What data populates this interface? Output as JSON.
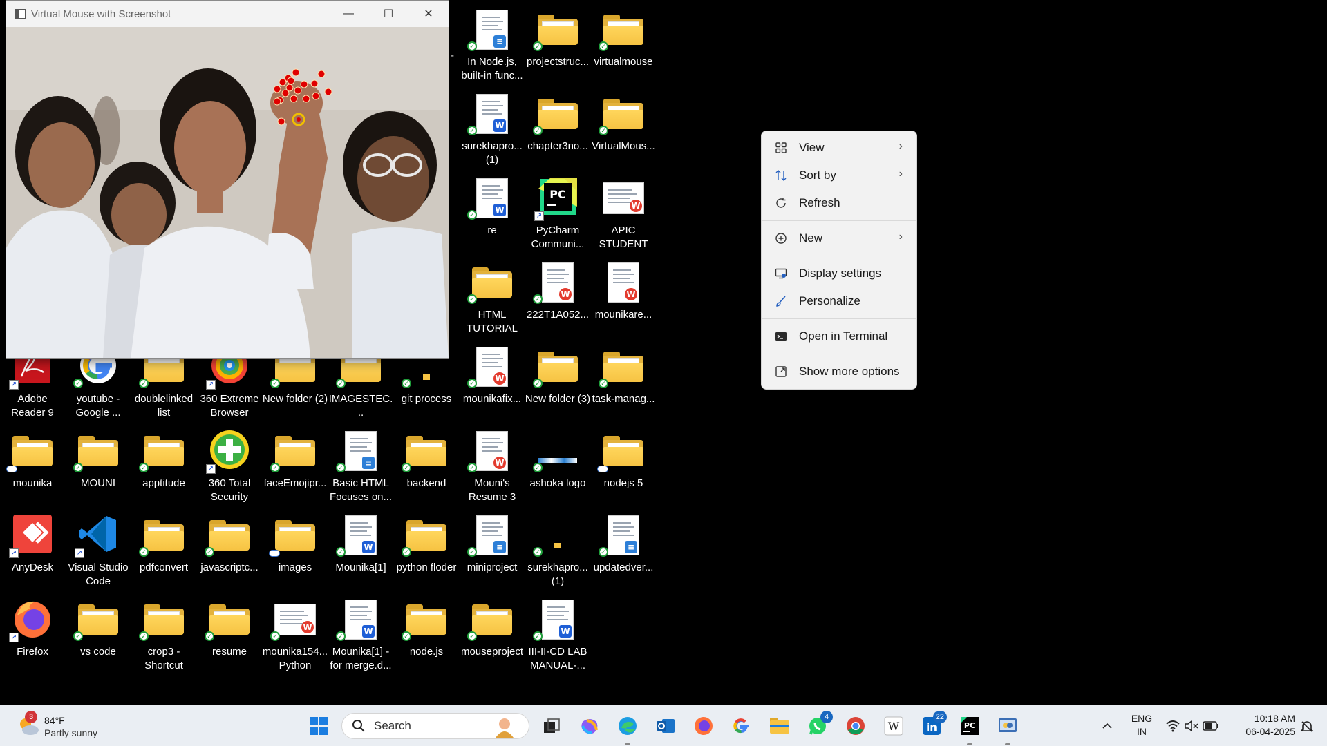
{
  "window": {
    "title": "Virtual Mouse with Screenshot",
    "minimize": "—",
    "maximize": "☐",
    "close": "✕"
  },
  "desktop_icons": [
    {
      "id": "adobe",
      "label": "Adobe Reader 9",
      "kind": "app",
      "icon": "adobe-reader-icon",
      "overlay": "shortcut"
    },
    {
      "id": "youtube",
      "label": "youtube - Google ...",
      "kind": "app",
      "icon": "google-chrome-app-icon",
      "overlay": "sync"
    },
    {
      "id": "doublelinked",
      "label": "doublelinked list",
      "kind": "folder",
      "overlay": "sync"
    },
    {
      "id": "360browser",
      "label": "360 Extreme Browser",
      "kind": "app",
      "icon": "360-browser-icon",
      "overlay": "shortcut"
    },
    {
      "id": "newfolder2",
      "label": "New folder (2)",
      "kind": "folder",
      "overlay": "sync"
    },
    {
      "id": "imagestec",
      "label": "IMAGESTEC...",
      "kind": "folder",
      "overlay": "sync"
    },
    {
      "id": "gitprocess",
      "label": "git process",
      "kind": "folder-small",
      "overlay": "sync"
    },
    {
      "id": "mounika",
      "label": "mounika",
      "kind": "folder",
      "overlay": "cloud"
    },
    {
      "id": "mouni",
      "label": "MOUNI",
      "kind": "folder",
      "overlay": "sync"
    },
    {
      "id": "apptitude",
      "label": "apptitude",
      "kind": "folder",
      "overlay": "sync"
    },
    {
      "id": "360security",
      "label": "360 Total Security",
      "kind": "app",
      "icon": "360-security-icon",
      "overlay": "shortcut"
    },
    {
      "id": "faceemoji",
      "label": "faceEmojipr...",
      "kind": "folder",
      "overlay": "sync"
    },
    {
      "id": "basichtml",
      "label": "Basic HTML Focuses on...",
      "kind": "doc",
      "badge": "note",
      "overlay": "sync"
    },
    {
      "id": "backend",
      "label": "backend",
      "kind": "folder",
      "overlay": "sync"
    },
    {
      "id": "anydesk",
      "label": "AnyDesk",
      "kind": "app",
      "icon": "anydesk-icon",
      "overlay": "shortcut"
    },
    {
      "id": "vscode",
      "label": "Visual Studio Code",
      "kind": "app",
      "icon": "vscode-icon",
      "overlay": "shortcut"
    },
    {
      "id": "pdfconvert",
      "label": "pdfconvert",
      "kind": "folder",
      "overlay": "sync"
    },
    {
      "id": "javascriptc",
      "label": "javascriptc...",
      "kind": "folder",
      "overlay": "sync"
    },
    {
      "id": "images",
      "label": "images",
      "kind": "folder",
      "overlay": "cloud"
    },
    {
      "id": "mounika1",
      "label": "Mounika[1]",
      "kind": "doc",
      "badge": "w",
      "overlay": "sync"
    },
    {
      "id": "pythonfloder",
      "label": "python floder",
      "kind": "folder",
      "overlay": "sync"
    },
    {
      "id": "firefox",
      "label": "Firefox",
      "kind": "app",
      "icon": "firefox-icon",
      "overlay": "shortcut"
    },
    {
      "id": "vscodefolder",
      "label": "vs code",
      "kind": "folder",
      "overlay": "sync"
    },
    {
      "id": "crop3",
      "label": "crop3 - Shortcut",
      "kind": "folder",
      "overlay": "sync"
    },
    {
      "id": "resume",
      "label": "resume",
      "kind": "folder",
      "overlay": "sync"
    },
    {
      "id": "mounika154",
      "label": "mounika154... Python",
      "kind": "doc-wide",
      "badge": "wps",
      "overlay": "sync"
    },
    {
      "id": "mounika1merge",
      "label": "Mounika[1] - for merge.d...",
      "kind": "doc",
      "badge": "w",
      "overlay": "sync"
    },
    {
      "id": "nodejs",
      "label": "node.js",
      "kind": "folder",
      "overlay": "sync"
    },
    {
      "id": "nodejsdoc",
      "label": "In Node.js, built-in func...",
      "kind": "doc",
      "badge": "note",
      "overlay": "sync"
    },
    {
      "id": "projectstruc",
      "label": "projectstruc...",
      "kind": "folder",
      "overlay": "sync"
    },
    {
      "id": "virtualmouse",
      "label": "virtualmouse",
      "kind": "folder",
      "overlay": "sync"
    },
    {
      "id": "surekhapro1",
      "label": "surekhapro... (1)",
      "kind": "doc",
      "badge": "w",
      "overlay": "sync"
    },
    {
      "id": "chapter3",
      "label": "chapter3no...",
      "kind": "folder",
      "overlay": "sync"
    },
    {
      "id": "virtualmous2",
      "label": "VirtualMous...",
      "kind": "folder",
      "overlay": "sync"
    },
    {
      "id": "re",
      "label": "re",
      "kind": "doc",
      "badge": "w",
      "overlay": "sync"
    },
    {
      "id": "pycharm",
      "label": "PyCharm Communi...",
      "kind": "app",
      "icon": "pycharm-icon",
      "overlay": "shortcut"
    },
    {
      "id": "apic",
      "label": "APIC STUDENT C...",
      "kind": "doc-wide",
      "badge": "wps",
      "overlay": "none"
    },
    {
      "id": "htmltut",
      "label": "HTML TUTORIAL",
      "kind": "folder",
      "overlay": "sync"
    },
    {
      "id": "222t1a",
      "label": "222T1A052...",
      "kind": "doc",
      "badge": "wps",
      "overlay": "sync"
    },
    {
      "id": "mounikare",
      "label": "mounikare...",
      "kind": "doc",
      "badge": "wps",
      "overlay": "none"
    },
    {
      "id": "mounikafix",
      "label": "mounikafix...",
      "kind": "doc",
      "badge": "wps",
      "overlay": "sync"
    },
    {
      "id": "newfolder3",
      "label": "New folder (3)",
      "kind": "folder",
      "overlay": "sync"
    },
    {
      "id": "taskmanag",
      "label": "task-manag...",
      "kind": "folder",
      "overlay": "sync"
    },
    {
      "id": "mounisresume",
      "label": "Mouni's Resume 3",
      "kind": "doc",
      "badge": "wps",
      "overlay": "sync"
    },
    {
      "id": "ashoka",
      "label": "ashoka logo",
      "kind": "image-strip",
      "overlay": "sync"
    },
    {
      "id": "nodejs5",
      "label": "nodejs 5",
      "kind": "folder",
      "overlay": "cloud"
    },
    {
      "id": "miniproject",
      "label": "miniproject",
      "kind": "doc",
      "badge": "note",
      "overlay": "sync"
    },
    {
      "id": "surekhapro1b",
      "label": "surekhapro... (1)",
      "kind": "folder-small",
      "overlay": "sync"
    },
    {
      "id": "updatedver",
      "label": "updatedver...",
      "kind": "doc",
      "badge": "note",
      "overlay": "sync"
    },
    {
      "id": "mouseproject",
      "label": "mouseproject",
      "kind": "folder",
      "overlay": "sync"
    },
    {
      "id": "iiiiicd",
      "label": "III-II-CD LAB MANUAL-...",
      "kind": "doc",
      "badge": "w",
      "overlay": "sync"
    }
  ],
  "stray_dash": "-",
  "context_menu": {
    "items": [
      {
        "label": "View",
        "icon": "grid-view-icon",
        "submenu": true
      },
      {
        "label": "Sort by",
        "icon": "sort-icon",
        "submenu": true
      },
      {
        "label": "Refresh",
        "icon": "refresh-icon",
        "submenu": false
      },
      {
        "label": "New",
        "icon": "plus-circle-icon",
        "submenu": true
      },
      {
        "label": "Display settings",
        "icon": "display-settings-icon",
        "submenu": false
      },
      {
        "label": "Personalize",
        "icon": "brush-icon",
        "submenu": false
      },
      {
        "label": "Open in Terminal",
        "icon": "terminal-icon",
        "submenu": false
      },
      {
        "label": "Show more options",
        "icon": "show-more-icon",
        "submenu": false
      }
    ]
  },
  "taskbar": {
    "weather_temp": "84°F",
    "weather_desc": "Partly sunny",
    "weather_badge": "3",
    "search_placeholder": "Search",
    "lang": "ENG",
    "region": "IN",
    "time": "10:18 AM",
    "date": "06-04-2025",
    "whatsapp_badge": "4",
    "linkedin_badge": "22",
    "apps": [
      "windows-start-icon",
      "task-view-icon",
      "copilot-icon",
      "edge-icon",
      "outlook-icon",
      "firefox-icon",
      "google-icon",
      "file-explorer-icon",
      "whatsapp-icon",
      "chrome-icon",
      "wikipedia-icon",
      "linkedin-icon",
      "pycharm-icon",
      "python-app-icon"
    ]
  },
  "colors": {
    "desktop_bg": "#000000",
    "taskbar_bg": "#eaeef3",
    "menu_bg": "#f2f2f2",
    "folder_yellow": "#f6c343",
    "landmark_red": "#e00000"
  }
}
